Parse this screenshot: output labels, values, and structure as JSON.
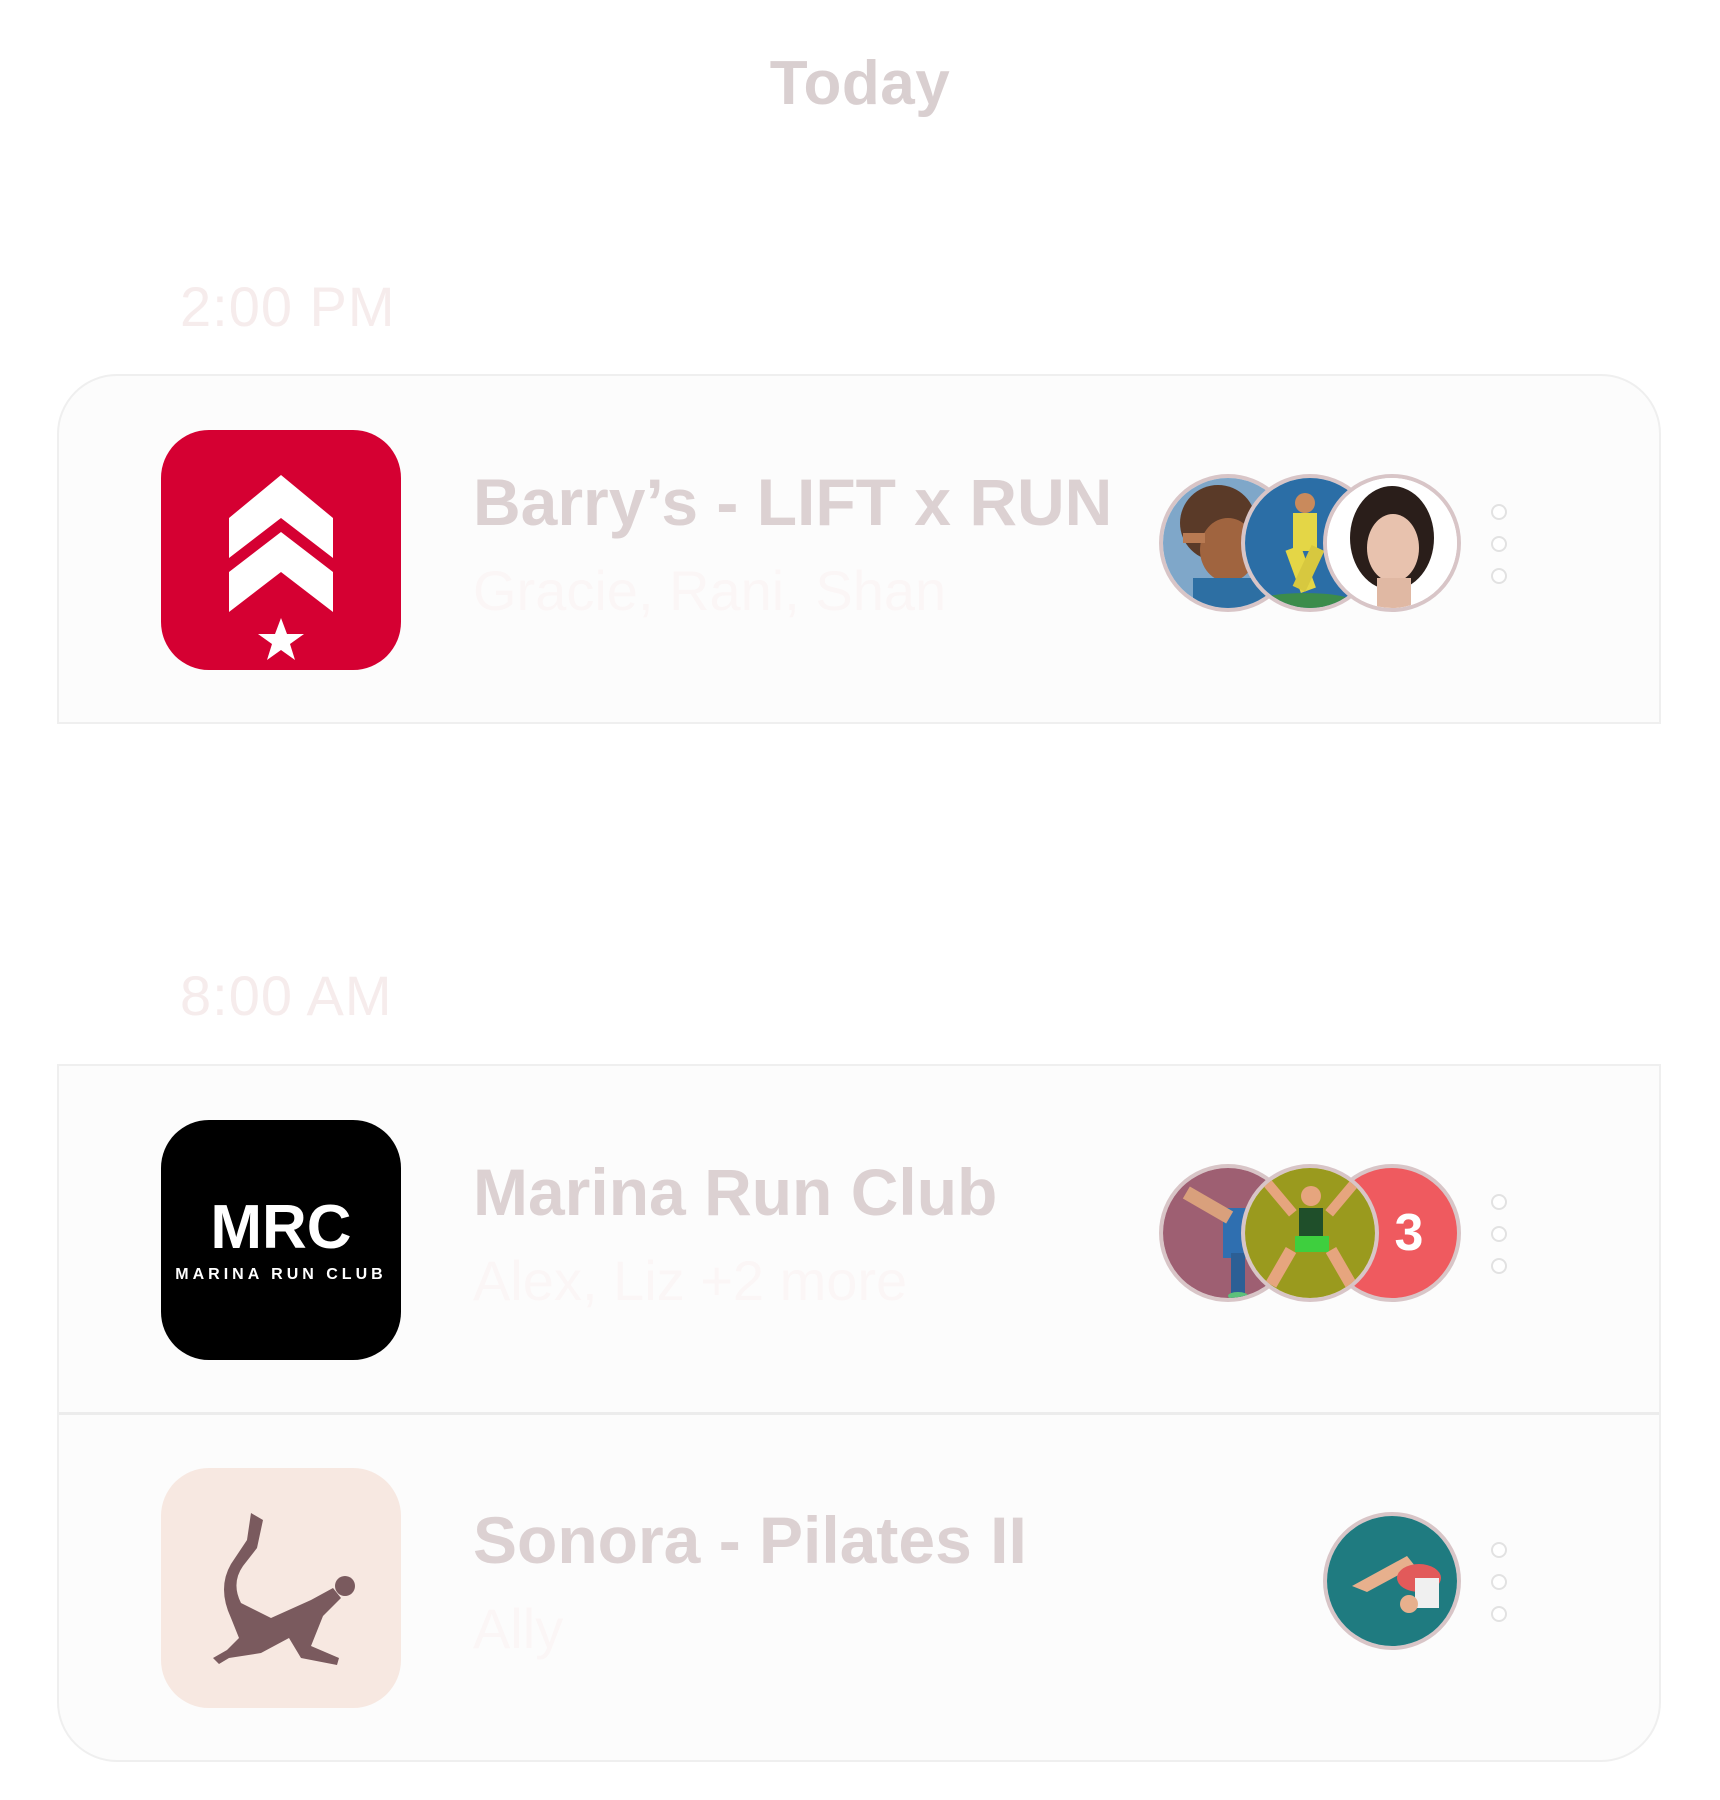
{
  "header": {
    "title": "Today"
  },
  "sections": [
    {
      "time": "2:00 PM",
      "events": [
        {
          "title": "Barry’s - LIFT x RUN",
          "attendees": "Gracie, Rani, Shan",
          "icon": "barrys-chevron-star-logo",
          "icon_bg": "#d50032",
          "avatars": [
            "person-hands-on-face-avatar",
            "soccer-player-avatar",
            "woman-portrait-avatar"
          ]
        }
      ]
    },
    {
      "time": "8:00 AM",
      "events": [
        {
          "title": "Marina Run Club",
          "attendees": "Alex, Liz +2 more",
          "icon": "mrc-logo",
          "icon_bg": "#000000",
          "logo_main": "MRC",
          "logo_sub": "MARINA RUN CLUB",
          "avatars": [
            "yoga-kick-avatar",
            "dancer-avatar"
          ],
          "extra_count": "3"
        },
        {
          "title": "Sonora - Pilates II",
          "attendees": "Ally",
          "icon": "yoga-pose-silhouette-logo",
          "icon_bg": "#f7e8e1",
          "avatars": [
            "plow-pose-avatar"
          ]
        }
      ]
    }
  ],
  "colors": {
    "title": "#d9cfd0",
    "time_label": "#f6ecec",
    "event_title": "#dcd1d2",
    "avatar_border": "#d8c5c7",
    "count_badge": "#ef5a5f"
  }
}
